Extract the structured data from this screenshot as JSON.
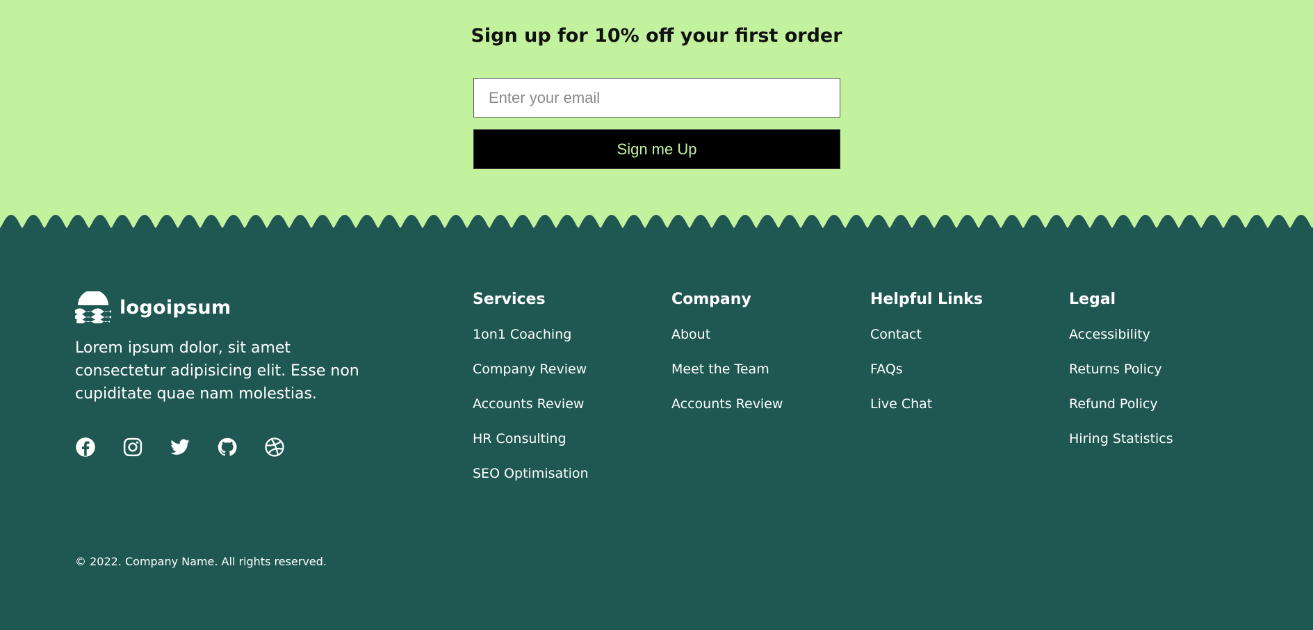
{
  "signup": {
    "title": "Sign up for 10% off your first order",
    "email_placeholder": "Enter your email",
    "email_value": "",
    "button_label": "Sign me Up"
  },
  "colors": {
    "mint": "#c3f29f",
    "footer_green": "#1f5853",
    "button_black": "#000000"
  },
  "footer": {
    "brand_name": "logoipsum",
    "description": "Lorem ipsum dolor, sit amet consectetur adipisicing elit. Esse non cupiditate quae nam molestias.",
    "socials": [
      "facebook-icon",
      "instagram-icon",
      "twitter-icon",
      "github-icon",
      "dribbble-icon"
    ],
    "columns": [
      {
        "title": "Services",
        "links": [
          "1on1 Coaching",
          "Company Review",
          "Accounts Review",
          "HR Consulting",
          "SEO Optimisation"
        ]
      },
      {
        "title": "Company",
        "links": [
          "About",
          "Meet the Team",
          "Accounts Review"
        ]
      },
      {
        "title": "Helpful Links",
        "links": [
          "Contact",
          "FAQs",
          "Live Chat"
        ]
      },
      {
        "title": "Legal",
        "links": [
          "Accessibility",
          "Returns Policy",
          "Refund Policy",
          "Hiring Statistics"
        ]
      }
    ],
    "copyright": "© 2022. Company Name. All rights reserved."
  }
}
